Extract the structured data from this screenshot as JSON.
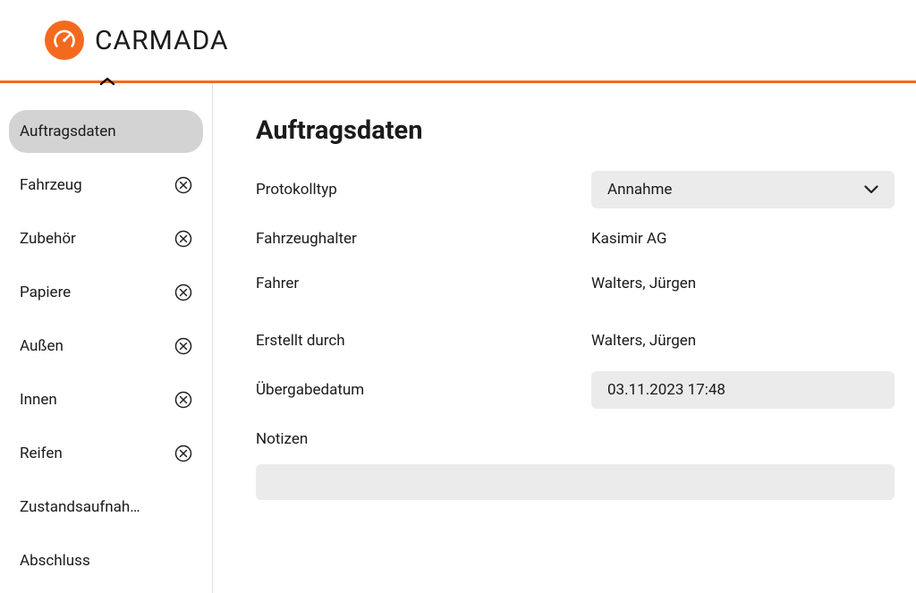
{
  "brand": {
    "name": "CARMADA"
  },
  "sidebar": {
    "items": [
      {
        "label": "Auftragsdaten",
        "hasStatus": false,
        "active": true
      },
      {
        "label": "Fahrzeug",
        "hasStatus": true,
        "active": false
      },
      {
        "label": "Zubehör",
        "hasStatus": true,
        "active": false
      },
      {
        "label": "Papiere",
        "hasStatus": true,
        "active": false
      },
      {
        "label": "Außen",
        "hasStatus": true,
        "active": false
      },
      {
        "label": "Innen",
        "hasStatus": true,
        "active": false
      },
      {
        "label": "Reifen",
        "hasStatus": true,
        "active": false
      },
      {
        "label": "Zustandsaufnah…",
        "hasStatus": false,
        "active": false
      },
      {
        "label": "Abschluss",
        "hasStatus": false,
        "active": false
      }
    ]
  },
  "page": {
    "title": "Auftragsdaten",
    "labels": {
      "protokolltyp": "Protokolltyp",
      "fahrzeughalter": "Fahrzeughalter",
      "fahrer": "Fahrer",
      "erstellt_durch": "Erstellt durch",
      "uebergabedatum": "Übergabedatum",
      "notizen": "Notizen"
    },
    "values": {
      "protokolltyp": "Annahme",
      "fahrzeughalter": "Kasimir AG",
      "fahrer": "Walters, Jürgen",
      "erstellt_durch": "Walters, Jürgen",
      "uebergabedatum": "03.11.2023 17:48",
      "notizen": ""
    }
  }
}
